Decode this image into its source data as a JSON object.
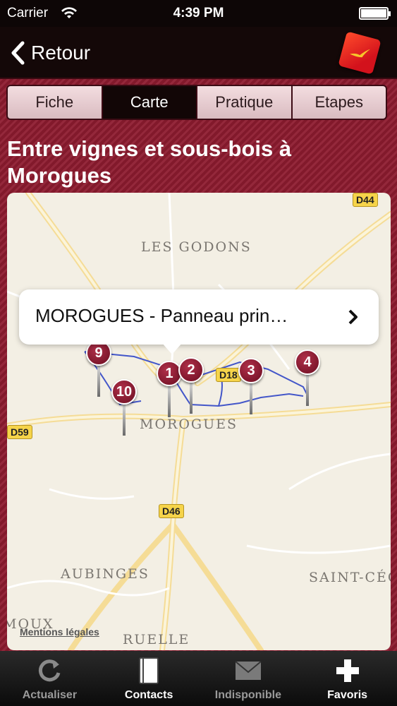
{
  "status": {
    "carrier": "Carrier",
    "time": "4:39 PM"
  },
  "nav": {
    "back_label": "Retour"
  },
  "segments": [
    {
      "label": "Fiche"
    },
    {
      "label": "Carte",
      "active": true
    },
    {
      "label": "Pratique"
    },
    {
      "label": "Etapes"
    }
  ],
  "title": "Entre vignes et sous-bois à Morogues",
  "map": {
    "places": {
      "les_godons": "LES GODONS",
      "morogues": "MOROGUES",
      "aubinges": "AUBINGES",
      "saint_ceci": "SAINT-CÉC",
      "ruelle": "RUELLE",
      "moux": "MOUX"
    },
    "roads": {
      "d44": "D44",
      "d18": "D18",
      "d59": "D59",
      "d46": "D46"
    },
    "pins": [
      "1",
      "2",
      "3",
      "4",
      "9",
      "10"
    ],
    "callout_text": "MOROGUES - Panneau prin…",
    "mentions": "Mentions légales"
  },
  "tabs": [
    {
      "label": "Actualiser",
      "icon": "refresh-icon"
    },
    {
      "label": "Contacts",
      "icon": "contacts-book-icon"
    },
    {
      "label": "Indisponible",
      "icon": "envelope-icon"
    },
    {
      "label": "Favoris",
      "icon": "plus-icon"
    }
  ]
}
